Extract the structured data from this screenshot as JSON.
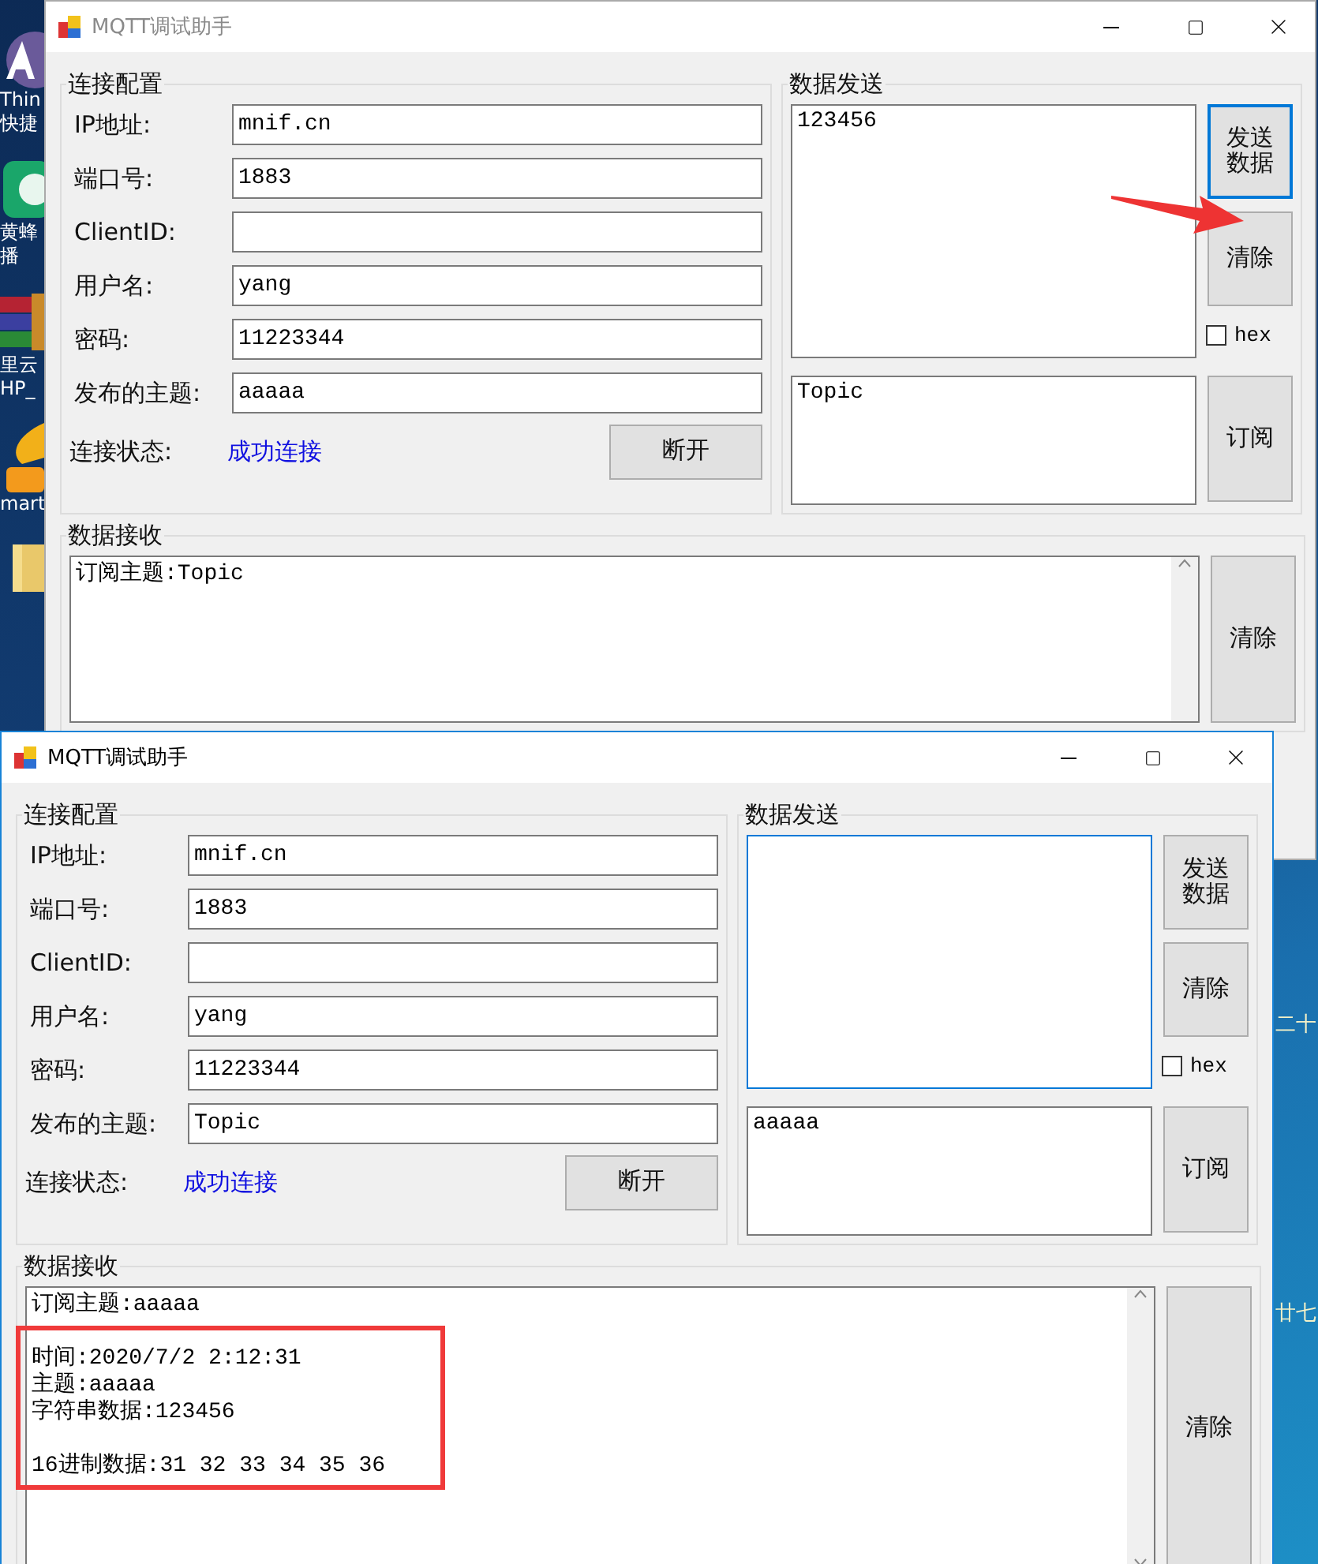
{
  "desktop": {
    "icons": [
      {
        "kind": "globe",
        "lines": [
          "Thin",
          "快捷"
        ]
      },
      {
        "kind": "player",
        "lines": [
          "黄蜂",
          "播"
        ]
      },
      {
        "kind": "archive",
        "lines": [
          "里云",
          "HP_"
        ]
      },
      {
        "kind": "cloud",
        "lines": [
          "mart"
        ]
      },
      {
        "kind": "folder"
      }
    ],
    "calendar": [
      "二十",
      "廿七"
    ]
  },
  "windows": [
    {
      "title": "MQTT调试助手",
      "active": false,
      "config": {
        "title": "连接配置",
        "fields": [
          {
            "label": "IP地址:",
            "value": "mnif.cn"
          },
          {
            "label": "端口号:",
            "value": "1883"
          },
          {
            "label": "ClientID:"
          },
          {
            "label": "用户名:",
            "value": "yang"
          },
          {
            "label": "密码:",
            "value": "11223344"
          },
          {
            "label": "发布的主题:",
            "value": "aaaaa"
          }
        ],
        "status_label": "连接状态:",
        "status_value": "成功连接",
        "disconnect_button": "断开"
      },
      "send": {
        "title": "数据发送",
        "message": "123456",
        "focused": false,
        "send_button": "发送数据",
        "clear_button": "清除",
        "hex_label": "hex",
        "hex_checked": false,
        "topic": "Topic",
        "subscribe_button": "订阅"
      },
      "receive": {
        "title": "数据接收",
        "text": "订阅主题:Topic",
        "clear_button": "清除"
      },
      "annotations": [
        {
          "kind": "arrow"
        }
      ]
    },
    {
      "title": "MQTT调试助手",
      "active": true,
      "config": {
        "title": "连接配置",
        "fields": [
          {
            "label": "IP地址:",
            "value": "mnif.cn"
          },
          {
            "label": "端口号:",
            "value": "1883"
          },
          {
            "label": "ClientID:"
          },
          {
            "label": "用户名:",
            "value": "yang"
          },
          {
            "label": "密码:",
            "value": "11223344"
          },
          {
            "label": "发布的主题:",
            "value": "Topic"
          }
        ],
        "status_label": "连接状态:",
        "status_value": "成功连接",
        "disconnect_button": "断开"
      },
      "send": {
        "title": "数据发送",
        "focused": true,
        "send_button": "发送数据",
        "clear_button": "清除",
        "hex_label": "hex",
        "hex_checked": false,
        "topic": "aaaaa",
        "subscribe_button": "订阅"
      },
      "receive": {
        "title": "数据接收",
        "text": "订阅主题:aaaaa\n\n时间:2020/7/2 2:12:31\n主题:aaaaa\n字符串数据:123456\n\n16进制数据:31 32 33 34 35 36",
        "clear_button": "清除"
      },
      "annotations": [
        {
          "kind": "highlight"
        }
      ]
    }
  ]
}
